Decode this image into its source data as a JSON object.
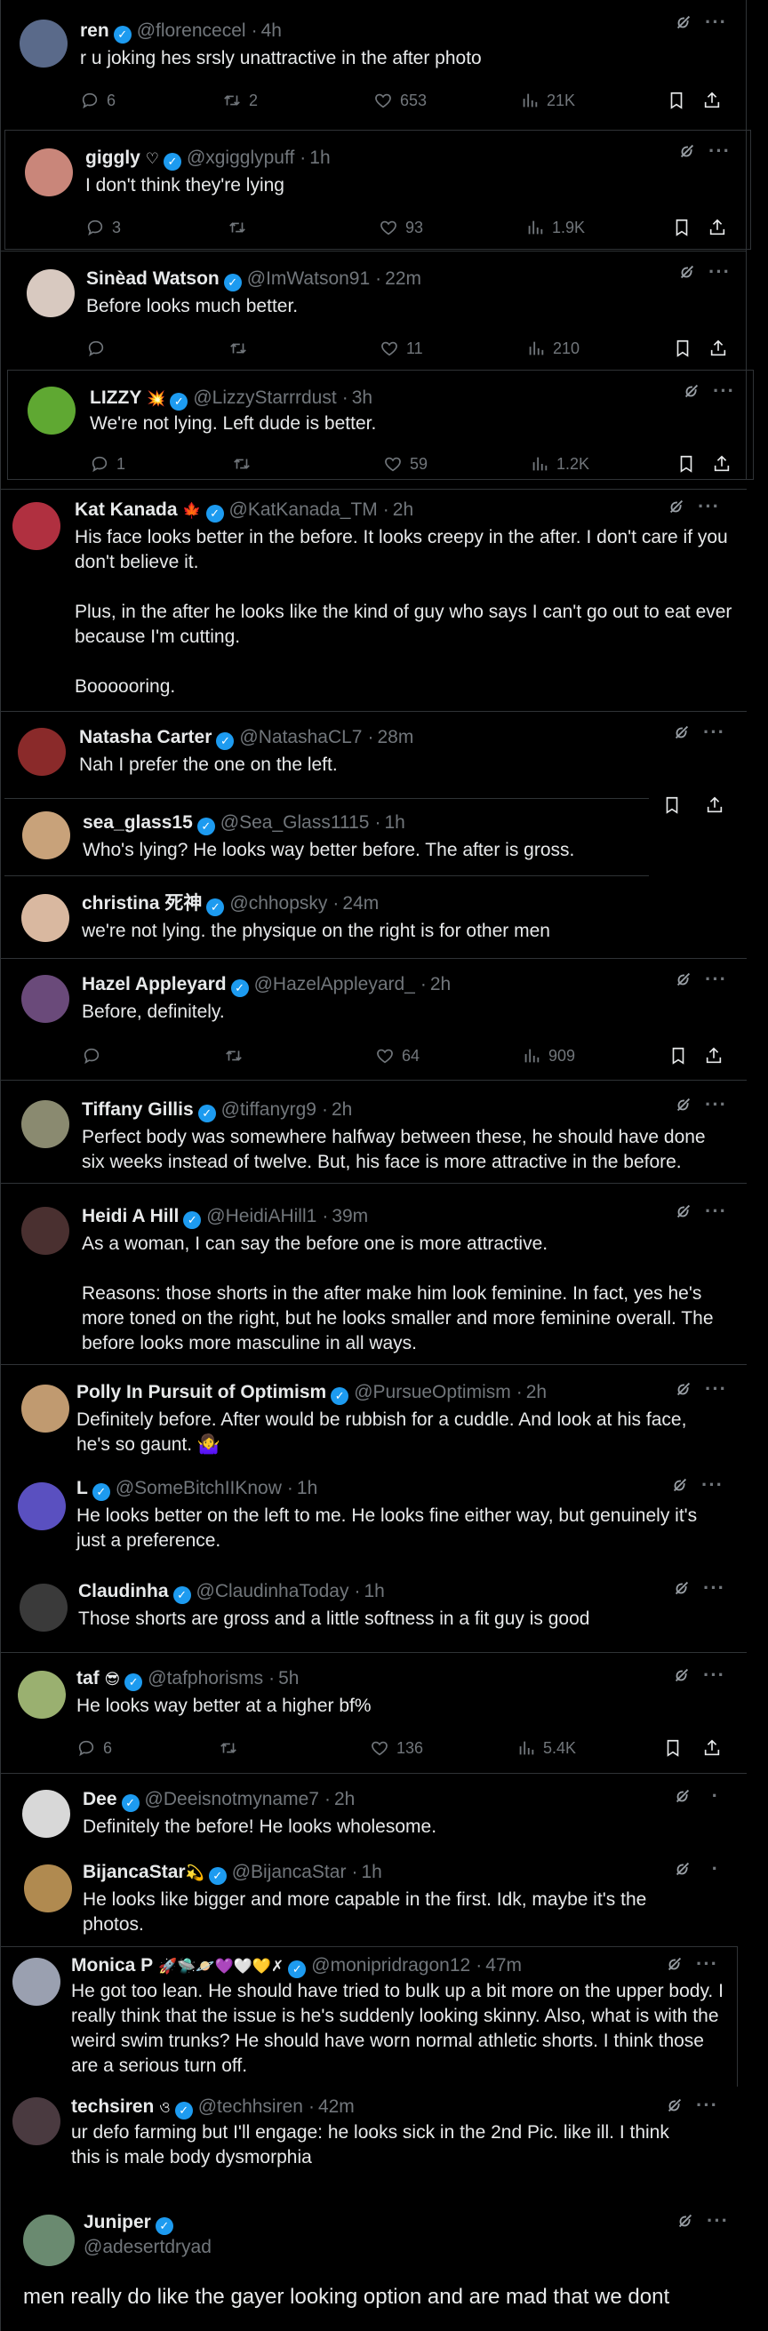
{
  "tweets": [
    {
      "name": "ren",
      "emoji": "",
      "handle": "@florencecel",
      "time": "4h",
      "text": "r u joking hes srsly unattractive in the after photo",
      "avatar_color": "#5a6a8a",
      "stats": {
        "reply": "6",
        "retweet": "2",
        "like": "653",
        "views": "21K"
      }
    },
    {
      "name": "giggly",
      "emoji": "♡",
      "handle": "@xgigglypuff",
      "time": "1h",
      "text": "I don't think they're lying",
      "avatar_color": "#c9867a",
      "stats": {
        "reply": "3",
        "retweet": "",
        "like": "93",
        "views": "1.9K"
      }
    },
    {
      "name": "Sinèad Watson",
      "emoji": "",
      "handle": "@ImWatson91",
      "time": "22m",
      "text": "Before looks much better.",
      "avatar_color": "#d8c9c0",
      "stats": {
        "reply": "",
        "retweet": "",
        "like": "11",
        "views": "210"
      }
    },
    {
      "name": "LIZZY",
      "emoji": "💥",
      "handle": "@LizzyStarrrdust",
      "time": "3h",
      "text": "We're not lying. Left dude is better.",
      "avatar_color": "#5fa832",
      "stats": {
        "reply": "1",
        "retweet": "",
        "like": "59",
        "views": "1.2K"
      }
    },
    {
      "name": "Kat Kanada",
      "emoji": "🍁",
      "handle": "@KatKanada_TM",
      "time": "2h",
      "text": "His face looks better in the before. It looks creepy in the after. I don't care if you don't believe it.\n\nPlus, in the after he looks like the kind of guy who says I can't go out to eat ever because I'm cutting.\n\nBoooooring.",
      "avatar_color": "#b03040"
    },
    {
      "name": "Natasha Carter",
      "emoji": "",
      "handle": "@NatashaCL7",
      "time": "28m",
      "text": "Nah I prefer the one on the left.",
      "avatar_color": "#8a2a2a"
    },
    {
      "name": "sea_glass15",
      "emoji": "",
      "handle": "@Sea_Glass1115",
      "time": "1h",
      "text": "Who's lying? He looks way better before. The after is gross.",
      "avatar_color": "#c8a27a"
    },
    {
      "name": "christina 死神",
      "emoji": "",
      "handle": "@chhopsky",
      "time": "24m",
      "text": "we're not lying. the physique on the right is for other men",
      "avatar_color": "#d9b8a0"
    },
    {
      "name": "Hazel Appleyard",
      "emoji": "",
      "handle": "@HazelAppleyard_",
      "time": "2h",
      "text": "Before, definitely.",
      "avatar_color": "#6a4a7a",
      "stats": {
        "reply": "",
        "retweet": "",
        "like": "64",
        "views": "909"
      }
    },
    {
      "name": "Tiffany Gillis",
      "emoji": "",
      "handle": "@tiffanyrg9",
      "time": "2h",
      "text": "Perfect body was somewhere halfway between these, he should have done six weeks instead of twelve. But, his face is more attractive in the before.",
      "avatar_color": "#8a8a70"
    },
    {
      "name": "Heidi A Hill",
      "emoji": "",
      "handle": "@HeidiAHill1",
      "time": "39m",
      "text": "As a woman, I can say the before one is more attractive.\n\nReasons: those shorts in the after make him look feminine. In fact, yes he's more toned on the right, but he looks smaller and more feminine overall. The before looks more masculine in all ways.",
      "avatar_color": "#4a3030"
    },
    {
      "name": "Polly In Pursuit of Optimism",
      "emoji": "",
      "handle": "@PursueOptimism",
      "time": "2h",
      "text": "Definitely before. After would be rubbish for a cuddle. And look at his face, he's so gaunt. 🤷‍♀️",
      "avatar_color": "#c09a70"
    },
    {
      "name": "L",
      "emoji": "",
      "handle": "@SomeBitchIIKnow",
      "time": "1h",
      "text": "He looks better on the left to me. He looks fine either way, but genuinely it's just a preference.",
      "avatar_color": "#5a50c0"
    },
    {
      "name": "Claudinha",
      "emoji": "",
      "handle": "@ClaudinhaToday",
      "time": "1h",
      "text": "Those shorts are gross and a little softness in a fit guy is good",
      "avatar_color": "#3a3a3a"
    },
    {
      "name": "taf",
      "emoji": "😎",
      "handle": "@tafphorisms",
      "time": "5h",
      "text": "He looks way better at a higher bf%",
      "avatar_color": "#9ab070",
      "stats": {
        "reply": "6",
        "retweet": "",
        "like": "136",
        "views": "5.4K"
      }
    },
    {
      "name": "Dee",
      "emoji": "",
      "handle": "@Deeisnotmyname7",
      "time": "2h",
      "text": "Definitely the before! He looks wholesome.",
      "avatar_color": "#d8d8d8"
    },
    {
      "name": "BijancaStar",
      "emoji": "💫",
      "handle": "@BijancaStar",
      "time": "1h",
      "text": "He looks like bigger and more capable in the first. Idk, maybe it's the photos.",
      "avatar_color": "#b08a50"
    },
    {
      "name": "Monica P",
      "emoji": "🚀🛸🪐💜🤍💛✗",
      "handle": "@monipridragon12",
      "time": "47m",
      "text": "He got too lean. He should have tried to bulk up a bit more on the upper body. I really think that the issue is he's suddenly looking skinny. Also, what is with the weird swim trunks? He should have worn normal athletic shorts. I think those are a serious turn off.",
      "avatar_color": "#9aa0b0"
    },
    {
      "name": "techsiren",
      "emoji": "ও",
      "handle": "@techhsiren",
      "time": "42m",
      "text": "ur defo farming but I'll engage: he looks sick in the 2nd Pic.  like ill. I think this is male body dysmorphia",
      "avatar_color": "#4a3a40"
    },
    {
      "name": "Juniper",
      "emoji": "",
      "handle": "@adesertdryad",
      "time": "",
      "text": "men really do like the gayer looking option and are mad that we dont",
      "avatar_color": "#6a8a70"
    }
  ]
}
